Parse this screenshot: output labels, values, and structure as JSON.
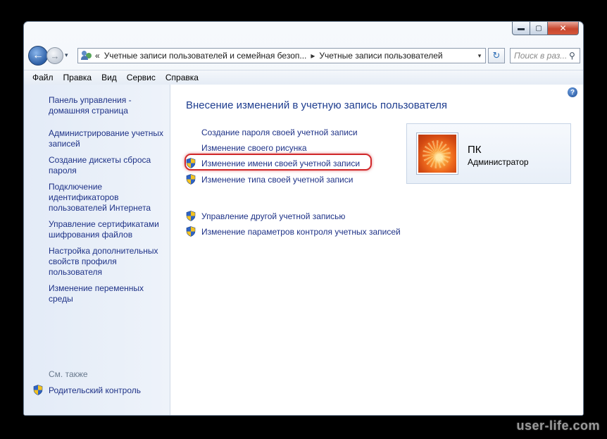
{
  "window": {
    "caption": {
      "minimize": "▬",
      "maximize": "▢",
      "close": "✕"
    }
  },
  "nav": {
    "back": "←",
    "forward": "→",
    "history_dropdown": "▾",
    "breadcrumb": [
      "«",
      "Учетные записи пользователей и семейная безоп...",
      "▸",
      "Учетные записи пользователей"
    ],
    "address_dropdown": "▾",
    "refresh": "↻",
    "search_placeholder": "Поиск в раз...",
    "search_icon": "⚲"
  },
  "menu": {
    "items": [
      {
        "label": "Файл"
      },
      {
        "label": "Правка"
      },
      {
        "label": "Вид"
      },
      {
        "label": "Сервис"
      },
      {
        "label": "Справка"
      }
    ]
  },
  "sidebar": {
    "items": [
      {
        "label": "Панель управления - домашняя страница"
      },
      {
        "label": "Администрирование учетных записей"
      },
      {
        "label": "Создание дискеты сброса пароля"
      },
      {
        "label": "Подключение идентификаторов пользователей Интернета"
      },
      {
        "label": "Управление сертификатами шифрования файлов"
      },
      {
        "label": "Настройка дополнительных свойств профиля пользователя"
      },
      {
        "label": "Изменение переменных среды"
      }
    ],
    "see_also": "См. также",
    "parental_control": "Родительский контроль"
  },
  "main": {
    "help": "?",
    "heading": "Внесение изменений в учетную запись пользователя",
    "tasks": [
      {
        "label": "Создание пароля своей учетной записи"
      },
      {
        "label": "Изменение своего рисунка"
      },
      {
        "label": "Изменение имени своей учетной записи"
      },
      {
        "label": "Изменение типа своей учетной записи"
      }
    ],
    "other_tasks": [
      {
        "label": "Управление другой учетной записью"
      },
      {
        "label": "Изменение параметров контроля учетных записей"
      }
    ]
  },
  "user": {
    "name": "ПК",
    "role": "Администратор"
  },
  "watermark": "user-life.com"
}
